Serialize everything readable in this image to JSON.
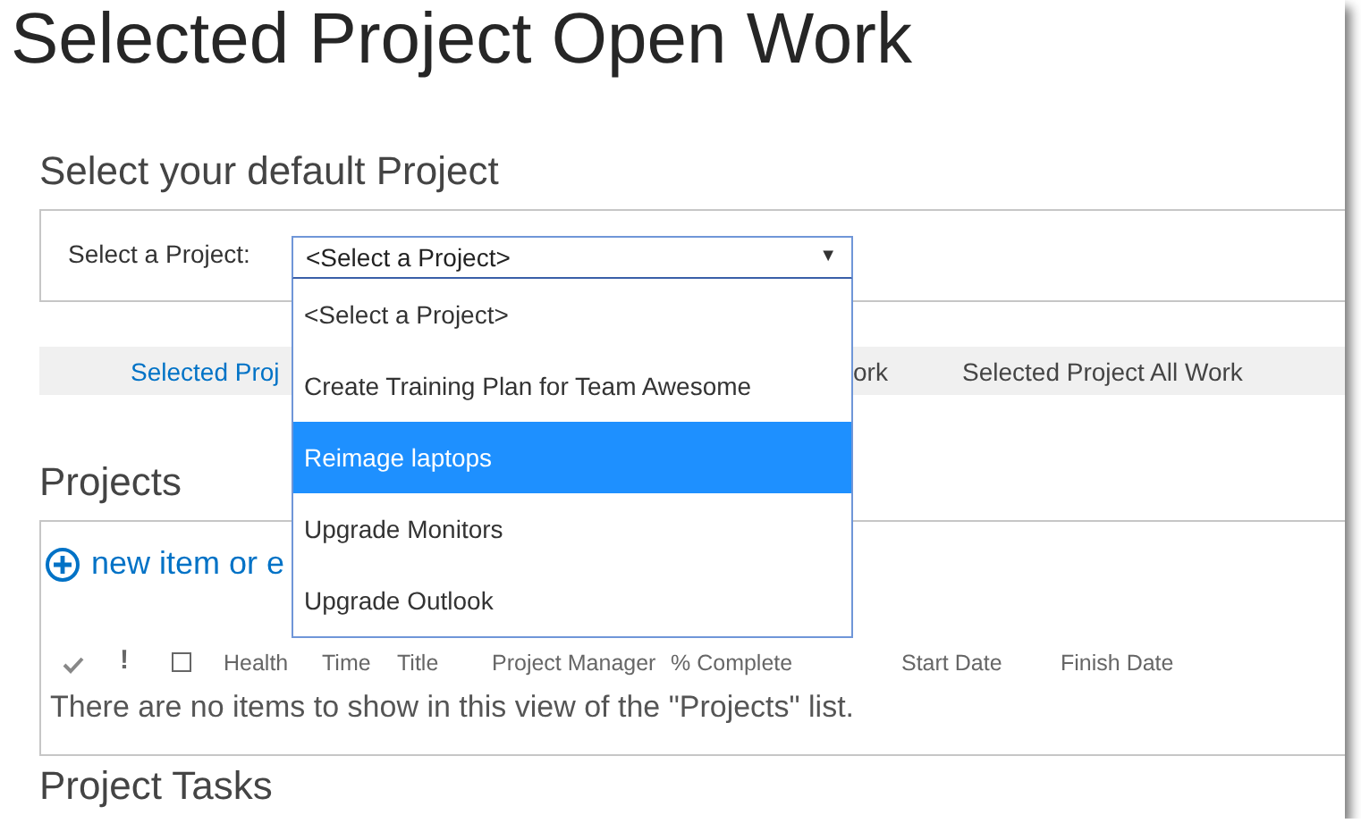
{
  "page_title": "Selected Project Open Work",
  "default_project": {
    "heading": "Select your default Project",
    "label": "Select a Project:",
    "value": "<Select a Project>",
    "arrow": "▼",
    "options": [
      {
        "label": "<Select a Project>",
        "highlighted": false
      },
      {
        "label": "Create Training Plan for Team Awesome",
        "highlighted": false
      },
      {
        "label": "Reimage laptops",
        "highlighted": true
      },
      {
        "label": "Upgrade Monitors",
        "highlighted": false
      },
      {
        "label": "Upgrade Outlook",
        "highlighted": false
      }
    ]
  },
  "tabs": [
    {
      "label": "Selected Proj"
    },
    {
      "label": "ork"
    },
    {
      "label": "Selected Project All Work"
    }
  ],
  "projects": {
    "heading": "Projects",
    "new_item": "new item or e",
    "columns": [
      "!",
      "Health",
      "Time",
      "Title",
      "Project Manager",
      "% Complete",
      "Start Date",
      "Finish Date"
    ],
    "empty_message": "There are no items to show in this view of the \"Projects\" list."
  },
  "next_section": {
    "heading": "Project Tasks"
  }
}
